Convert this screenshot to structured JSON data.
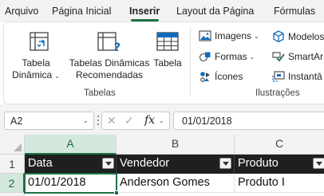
{
  "menu": {
    "tabs": [
      {
        "label": "Arquivo",
        "active": false
      },
      {
        "label": "Página Inicial",
        "active": false
      },
      {
        "label": "Inserir",
        "active": true
      },
      {
        "label": "Layout da Página",
        "active": false
      },
      {
        "label": "Fórmulas",
        "active": false
      }
    ]
  },
  "ribbon": {
    "tabelas": {
      "group_label": "Tabelas",
      "pivot_line1": "Tabela",
      "pivot_line2": "Dinâmica",
      "recommended_line1": "Tabelas Dinâmicas",
      "recommended_line2": "Recomendadas",
      "table_label": "Tabela"
    },
    "ilustracoes": {
      "group_label": "Ilustrações",
      "images_label": "Imagens",
      "shapes_label": "Formas",
      "icons_label": "Ícones",
      "models_label": "Modelos",
      "smartart_label": "SmartAr",
      "screenshot_label": "Instantâ"
    }
  },
  "formula_bar": {
    "name_box": "A2",
    "fx_label": "fx",
    "formula": "01/01/2018"
  },
  "grid": {
    "columns": [
      "A",
      "B",
      "C"
    ],
    "selected_column": "A",
    "rows": [
      "1",
      "2"
    ],
    "selected_row": "2",
    "header_row": [
      "Data",
      "Vendedor",
      "Produto"
    ],
    "data_row": [
      "01/01/2018",
      "Anderson Gomes",
      "Produto I"
    ],
    "active_cell": "A2"
  },
  "colors": {
    "accent": "#1e7145",
    "table_header_bg": "#1f1f1f",
    "selected_header_bg": "#d3e8dc"
  }
}
